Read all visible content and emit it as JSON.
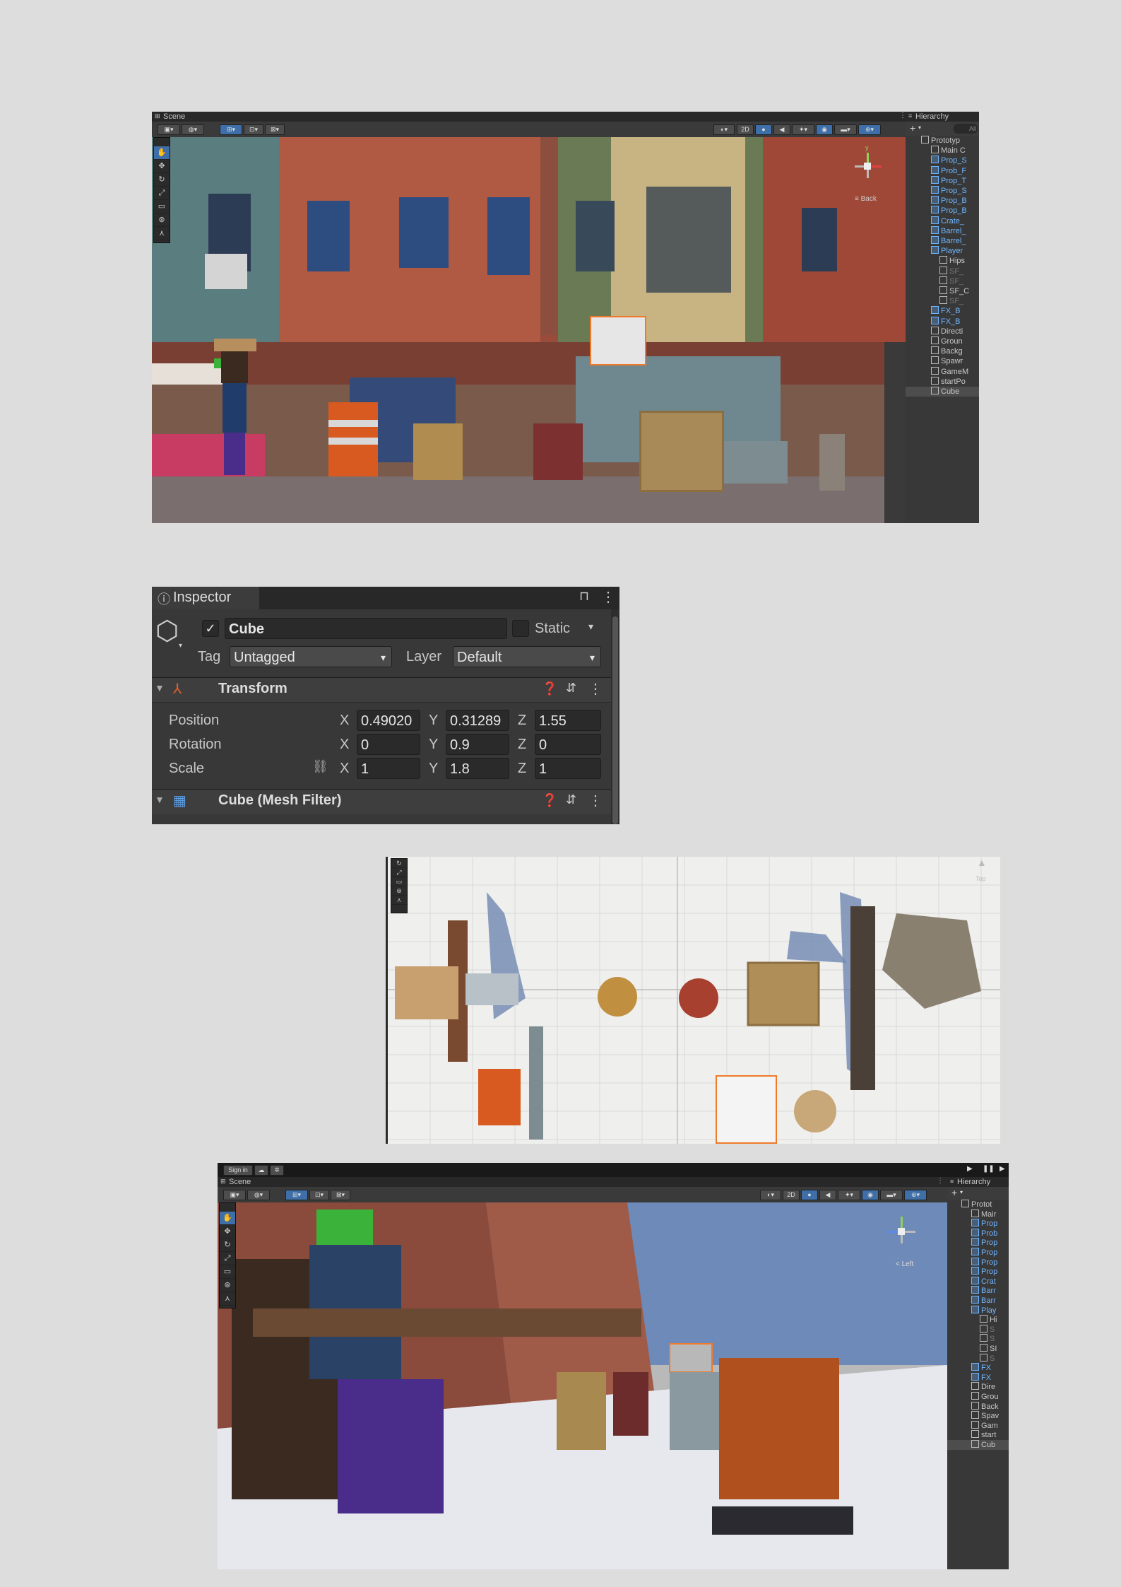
{
  "scene_top": {
    "tab_label": "Scene",
    "btn_2d": "2D",
    "gizmo_label": "≡ Back",
    "gizmo_axis_y": "y"
  },
  "hierarchy_top": {
    "tab_label": "Hierarchy",
    "add_label": "+",
    "search_placeholder": "All",
    "items": [
      {
        "label": "Prototyp",
        "style": "root"
      },
      {
        "label": "Main C",
        "style": "normal"
      },
      {
        "label": "Prop_S",
        "style": "blue"
      },
      {
        "label": "Prob_F",
        "style": "blue"
      },
      {
        "label": "Prop_T",
        "style": "blue"
      },
      {
        "label": "Prop_S",
        "style": "blue"
      },
      {
        "label": "Prop_B",
        "style": "blue"
      },
      {
        "label": "Prop_B",
        "style": "blue"
      },
      {
        "label": "Crate_",
        "style": "blue"
      },
      {
        "label": "Barrel_",
        "style": "blue"
      },
      {
        "label": "Barrel_",
        "style": "blue"
      },
      {
        "label": "Player",
        "style": "blue"
      },
      {
        "label": "Hips",
        "style": "child"
      },
      {
        "label": "SF_",
        "style": "dim"
      },
      {
        "label": "SF_",
        "style": "dim"
      },
      {
        "label": "SF_C",
        "style": "child"
      },
      {
        "label": "SF_",
        "style": "dim"
      },
      {
        "label": "FX_B",
        "style": "blue"
      },
      {
        "label": "FX_B",
        "style": "blue"
      },
      {
        "label": "Directi",
        "style": "normal"
      },
      {
        "label": "Groun",
        "style": "normal"
      },
      {
        "label": "Backg",
        "style": "normal"
      },
      {
        "label": "Spawr",
        "style": "normal"
      },
      {
        "label": "GameM",
        "style": "normal"
      },
      {
        "label": "startPo",
        "style": "normal"
      },
      {
        "label": "Cube",
        "style": "selected"
      }
    ]
  },
  "inspector": {
    "tab_label": "Inspector",
    "object_name": "Cube",
    "static_label": "Static",
    "tag_label": "Tag",
    "tag_value": "Untagged",
    "layer_label": "Layer",
    "layer_value": "Default",
    "transform_title": "Transform",
    "position_label": "Position",
    "rotation_label": "Rotation",
    "scale_label": "Scale",
    "axis_x": "X",
    "axis_y": "Y",
    "axis_z": "Z",
    "position": {
      "x": "0.49020",
      "y": "0.31289",
      "z": "1.55"
    },
    "rotation": {
      "x": "0",
      "y": "0.9",
      "z": "0"
    },
    "scale": {
      "x": "1",
      "y": "1.8",
      "z": "1"
    },
    "mesh_filter_title": "Cube (Mesh Filter)"
  },
  "scene_topdown": {
    "gizmo_label": "Top"
  },
  "scene_bottom": {
    "sign_in_label": "Sign in",
    "tab_label": "Scene",
    "btn_2d": "2D",
    "gizmo_label": "< Left"
  },
  "hierarchy_bottom": {
    "tab_label": "Hierarchy",
    "add_label": "+",
    "items": [
      {
        "label": "Protot",
        "style": "root"
      },
      {
        "label": "Mair",
        "style": "normal"
      },
      {
        "label": "Prop",
        "style": "blue"
      },
      {
        "label": "Prob",
        "style": "blue"
      },
      {
        "label": "Prop",
        "style": "blue"
      },
      {
        "label": "Prop",
        "style": "blue"
      },
      {
        "label": "Prop",
        "style": "blue"
      },
      {
        "label": "Prop",
        "style": "blue"
      },
      {
        "label": "Crat",
        "style": "blue"
      },
      {
        "label": "Barr",
        "style": "blue"
      },
      {
        "label": "Barr",
        "style": "blue"
      },
      {
        "label": "Play",
        "style": "blue"
      },
      {
        "label": "Hi",
        "style": "child"
      },
      {
        "label": "S",
        "style": "dim"
      },
      {
        "label": "S",
        "style": "dim"
      },
      {
        "label": "SI",
        "style": "child"
      },
      {
        "label": "S",
        "style": "dim"
      },
      {
        "label": "FX",
        "style": "blue"
      },
      {
        "label": "FX",
        "style": "blue"
      },
      {
        "label": "Dire",
        "style": "normal"
      },
      {
        "label": "Grou",
        "style": "normal"
      },
      {
        "label": "Back",
        "style": "normal"
      },
      {
        "label": "Spav",
        "style": "normal"
      },
      {
        "label": "Gam",
        "style": "normal"
      },
      {
        "label": "start",
        "style": "normal"
      },
      {
        "label": "Cub",
        "style": "selected"
      }
    ]
  }
}
